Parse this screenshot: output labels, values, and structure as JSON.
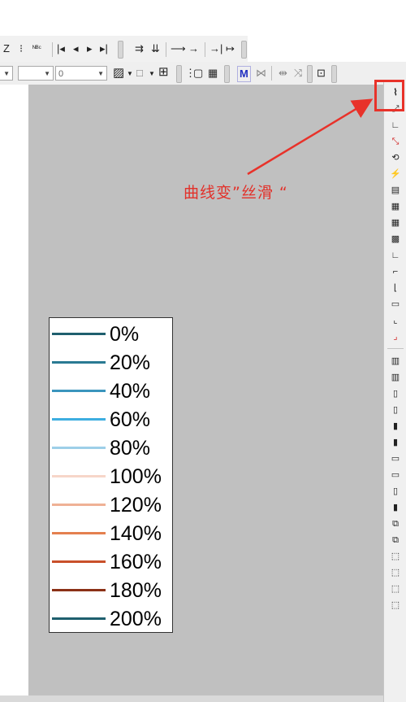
{
  "toolbar1": {
    "items": [
      {
        "name": "text-z-button",
        "label": "Z"
      },
      {
        "name": "text-dots-button",
        "label": "⁝"
      },
      {
        "name": "text-nbc-button",
        "label": "ᴺᴮᶜ"
      },
      {
        "name": "arrow-first-button",
        "label": "|◂"
      },
      {
        "name": "arrow-left-button",
        "label": "◂"
      },
      {
        "name": "arrow-right-button",
        "label": "▸"
      },
      {
        "name": "arrow-last-button",
        "label": "▸|"
      },
      {
        "name": "indent-button",
        "label": "⇉"
      },
      {
        "name": "tab-button",
        "label": "⇊"
      },
      {
        "name": "arrow-to-button",
        "label": "⟶"
      },
      {
        "name": "arrow-plain-button",
        "label": "→"
      },
      {
        "name": "arrow-end-button",
        "label": "→|"
      },
      {
        "name": "arrow-tail-button",
        "label": "↦"
      }
    ]
  },
  "toolbar2": {
    "combo_left": "",
    "combo_mid": "",
    "combo_value": "0",
    "fill_icon": "▨",
    "border_icon": "□",
    "table_icon": "⊞",
    "dots_icon": "⋮",
    "box_icon": "▢",
    "grid_icon": "▦",
    "m_icon": "M",
    "x_icon": "⋈",
    "align_icon": "⇹",
    "scatter_icon": "⤨",
    "lock_icon": "⊡"
  },
  "annotation": {
    "text": "曲线变”丝滑 “"
  },
  "right_toolbar": {
    "icons": [
      "⌇",
      "⤢",
      "∟",
      "⤡",
      "⟲",
      "⚡",
      "▤",
      "▦",
      "▦",
      "▩",
      "∟",
      "⌐",
      "⌊",
      "▭",
      "⌞",
      "⌟",
      "▥",
      "▥",
      "▯",
      "▯",
      "▮",
      "▮",
      "▭",
      "▭",
      "▯",
      "▮",
      "⧉",
      "⧉",
      "⬚",
      "⬚",
      "⬚",
      "⬚"
    ]
  },
  "legend": {
    "entries": [
      {
        "label": "0%",
        "color": "#1f5f6e"
      },
      {
        "label": "20%",
        "color": "#2a7a93"
      },
      {
        "label": "40%",
        "color": "#3a95bd"
      },
      {
        "label": "60%",
        "color": "#3daee0"
      },
      {
        "label": "80%",
        "color": "#9dcfe8"
      },
      {
        "label": "100%",
        "color": "#f7d6c9"
      },
      {
        "label": "120%",
        "color": "#efb195"
      },
      {
        "label": "140%",
        "color": "#e4804f"
      },
      {
        "label": "160%",
        "color": "#c9502a"
      },
      {
        "label": "180%",
        "color": "#8b3117"
      },
      {
        "label": "200%",
        "color": "#1f5f6e"
      }
    ]
  }
}
